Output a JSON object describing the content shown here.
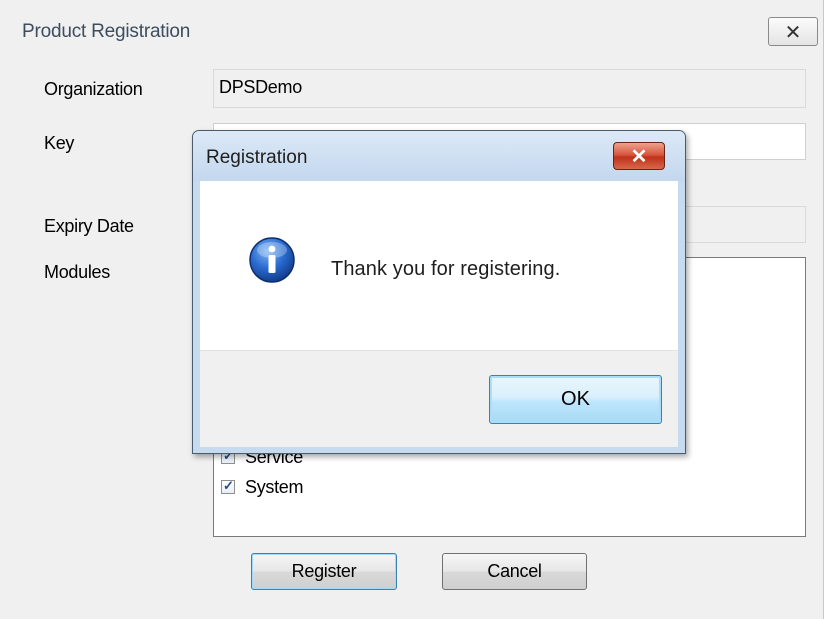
{
  "main_window": {
    "title": "Product Registration",
    "close_glyph": "✕",
    "labels": {
      "organization": "Organization",
      "key": "Key",
      "expiry_date": "Expiry Date",
      "modules": "Modules"
    },
    "organization_value": "DPSDemo",
    "key_value": "",
    "expiry_date_value": "",
    "modules": [
      {
        "label": "Service",
        "checked": true
      },
      {
        "label": "System",
        "checked": true
      }
    ],
    "register_label": "Register",
    "cancel_label": "Cancel"
  },
  "dialog": {
    "title": "Registration",
    "close_glyph": "✕",
    "icon": "info-icon",
    "message": "Thank you for registering.",
    "ok_label": "OK"
  },
  "colors": {
    "window_bg": "#f0f0f0",
    "dialog_frame": "#c7dbf0",
    "close_red": "#c0311a",
    "info_blue": "#1f5fb8",
    "default_button_border": "#3c7fb1"
  }
}
